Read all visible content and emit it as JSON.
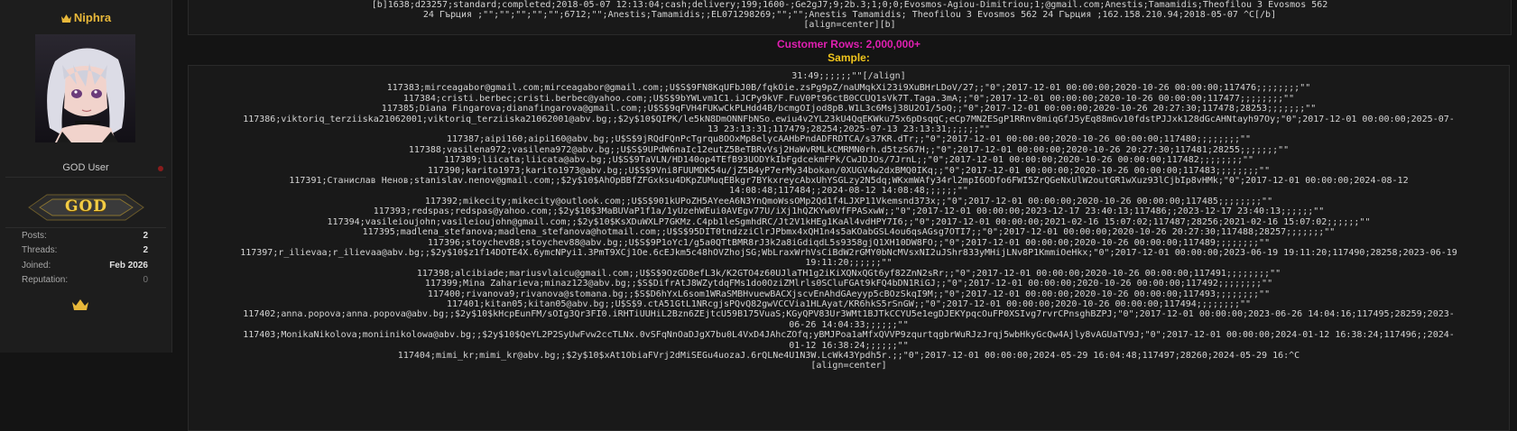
{
  "user": {
    "name": "Niphra",
    "title": "GOD User",
    "rank": "GOD",
    "stats": [
      {
        "label": "Posts:",
        "value": "2"
      },
      {
        "label": "Threads:",
        "value": "2"
      },
      {
        "label": "Joined:",
        "value": "Feb 2026"
      },
      {
        "label": "Reputation:",
        "value": "0"
      }
    ],
    "colors": {
      "name": "#e8b83a",
      "rank": "#f2cc45"
    },
    "icons": {
      "name_prefix": "crown-icon",
      "footer": "crown-icon",
      "online": "status-dot-icon"
    }
  },
  "top_block": {
    "lines": [
      "[b]1638;d23257;standard;completed;2018-05-07 12:13:04;cash;delivery;199;1600-;Ge2gJ7;9;2b.3;1;0;0;Evosmos-Agiou-Dimitriou;1;@gmail.com;Anestis;Tamamidis;Theofilou 3 Evosmos 562",
      "24 Гърция ;\"\";\"\";\"\";\"\";\"\";6712;\"\";Anestis;Tamamidis;;EL071298269;\"\";\"\";Anestis Tamamidis; Theofilou 3 Evosmos 562 24 Гърция ;162.158.210.94;2018-05-07 ^C[/b]",
      "[align=center][b]"
    ]
  },
  "headings": {
    "customers": "Customer Rows: 2,000,000+",
    "sample": "Sample:"
  },
  "sample": {
    "lines": [
      "31:49;;;;;;\"\"[/align]",
      "117383;mirceagabor@gmail.com;mirceagabor@gmail.com;;U$S$9FN8KqUFbJ0B/fqkOie.zsPg9pZ/naUMqkXi23i9XuBHrLDoV/27;;\"0\";2017-12-01 00:00:00;2020-10-26 00:00:00;117476;;;;;;;;\"\"",
      "117384;cristi.berbec;cristi.berbec@yahoo.com;;U$S$9bYWLvm1C1.iJCPy9kVF.FuV0Pt96ctB0CCUQ1sVk7T.Taga.3mA;;\"0\";2017-12-01 00:00:00;2020-10-26 00:00:00;117477;;;;;;;;\"\"",
      "117385;Diana Fingarova;dianafingarova@gmail.com;;U$S$9qFVH4FUKwCkPLHdd4B/bcmgOIjod8pB.W1L3c6Msj38U2O1/5oQ;;\"0\";2017-12-01 00:00:00;2020-10-26 20:27:30;117478;28253;;;;;;;\"\"",
      "117386;viktoriq_terziiska21062001;viktoriq_terziiska21062001@abv.bg;;$2y$10$QIPK/le5kN8DmONNFbNSo.ewiu4v2YL23kU4QqEKWku75x6pDsqqC;eCp7MN2ESgP1RRnv8miqGfJ5yEq88mGv10fdstPJJxk128dGcAHNtayh97Oy;\"0\";2017-12-01 00:00:00;2025-07-",
      "13 23:13:31;117479;28254;2025-07-13 23:13:31;;;;;;\"\"",
      "117387;aipi160;aipi160@abv.bg;;U$S$9jRQdFQnPcTgrqu8OOxMp8elycAAHbPndADFRDTCA/s37KR.dTr;;\"0\";2017-12-01 00:00:00;2020-10-26 00:00:00;117480;;;;;;;;\"\"",
      "117388;vasilena972;vasilena972@abv.bg;;U$S$9UPdW6naIc12eutZ5BeTBRvVsj2HaWvRMLkCMRMN0rh.d5tzS67H;;\"0\";2017-12-01 00:00:00;2020-10-26 20:27:30;117481;28255;;;;;;;\"\"",
      "117389;liicata;liicata@abv.bg;;U$S$9TaVLN/HD140op4TEfB93UODYkIbFgdcekmFPk/CwJDJOs/7JrnL;;\"0\";2017-12-01 00:00:00;2020-10-26 00:00:00;117482;;;;;;;;\"\"",
      "117390;karito1973;karito1973@abv.bg;;U$S$9Vni8FUUMDK54u/jZ5B4yP7erMy34bokan/0XUGV4w2dxBMQ0IKq;;\"0\";2017-12-01 00:00:00;2020-10-26 00:00:00;117483;;;;;;;;\"\"",
      "117391;Станислав Ненов;stanislav.nenov@gmail.com;;$2y$10$AhOpBBfZFGxksu4DKpZUMuqEBkgr7BYkxreycAbxUhYSGLzy2N5dq;WKxmWAfy34rl2mpI6ODfo6FWI5ZrQGeNxUlW2outGR1wXuz93lCjbIp8vHMk;\"0\";2017-12-01 00:00:00;2024-08-12",
      "14:08:48;117484;;2024-08-12 14:08:48;;;;;;\"\"",
      "117392;mikecity;mikecity@outlook.com;;U$S$901kUPoZH5AYeeA6N3YnQmoWssOMp2Qd1f4LJXP11Vkemsnd373x;;\"0\";2017-12-01 00:00:00;2020-10-26 00:00:00;117485;;;;;;;;\"\"",
      "117393;redspas;redspas@yahoo.com;;$2y$10$3MaBUVaP1f1a/1yUzehWEui0AVEgv77U/iXj1hQZKYw0VfFPASxwW;;\"0\";2017-12-01 00:00:00;2023-12-17 23:40:13;117486;;2023-12-17 23:40:13;;;;;;\"\"",
      "117394;vasileioujohn;vasileioujohn@gmail.com;;$2y$10$KsXDuWXLP7GKMz.C4pb1leSgmhdRC/Jt2V1kHEg1KaAl4vdHPY7I6;;\"0\";2017-12-01 00:00:00;2021-02-16 15:07:02;117487;28256;2021-02-16 15:07:02;;;;;;\"\"",
      "117395;madlena_stefanova;madlena_stefanova@hotmail.com;;U$S$95DIT0tndzziClrJPbmx4xQH1n4s5aKOabGSL4ou6qsAGsg7OTI7;;\"0\";2017-12-01 00:00:00;2020-10-26 20:27:30;117488;28257;;;;;;;\"\"",
      "117396;stoychev88;stoychev88@abv.bg;;U$S$9P1oYc1/g5a0QTtBMR8rJ3k2a8iGdiqdL5s9358gjQ1XH10DW8FO;;\"0\";2017-12-01 00:00:00;2020-10-26 00:00:00;117489;;;;;;;;\"\"",
      "117397;r_ilievaa;r_ilievaa@abv.bg;;$2y$10$z1f14DOTE4X.6ymcNPyi1.3PmT9XCj1Oe.6cEJkm5c48hOVZhojSG;WbLraxWrhVsCiBdW2rGMY0bNcMVsxNI2uJShr833yMHijLNv8P1KmmiOeHkx;\"0\";2017-12-01 00:00:00;2023-06-19 19:11:20;117490;28258;2023-06-19",
      "19:11:20;;;;;;\"\"",
      "117398;alcibiade;mariusvlaicu@gmail.com;;U$S$9OzGD8efL3k/K2GTO4z60UJlaTH1g2iKiXQNxQGt6yf82ZnN2sRr;;\"0\";2017-12-01 00:00:00;2020-10-26 00:00:00;117491;;;;;;;;\"\"",
      "117399;Mina Zaharieva;minaz123@abv.bg;;$S$DifrAtJ8WZytdqFMs1do0OziZMlrls0SCluFGAt9kFQ4bDN1RiGJ;;\"0\";2017-12-01 00:00:00;2020-10-26 00:00:00;117492;;;;;;;;\"\"",
      "117400;rivanova9;rivanova@stomana.bg;;$S$D6hYxL6som1WRaSMBHvuewBACXjscvEnAhdGAeyyp5cBOzSkqI9M;;\"0\";2017-12-01 00:00:00;2020-10-26 00:00:00;117493;;;;;;;;\"\"",
      "117401;kitan05;kitan05@abv.bg;;U$S$9.ctA51GtL1NRcgjsPQvQ82gwVCCVia1HLAyat/KR6hkS5rSnGW;;\"0\";2017-12-01 00:00:00;2020-10-26 00:00:00;117494;;;;;;;;\"\"",
      "117402;anna.popova;anna.popova@abv.bg;;$2y$10$kHcpEunFM/sOIg3Qr3FI0.iRHTiUUHiL2Bzn6ZEjtcU59B175VuaS;KGyQPV83Ur3WMt1BJTkCCYU5e1egDJEKYpqcOuFP0XSIvg7rvrCPnsghBZPJ;\"0\";2017-12-01 00:00:00;2023-06-26 14:04:16;117495;28259;2023-",
      "06-26 14:04:33;;;;;;\"\"",
      "117403;MonikaNikolova;moniinikolowa@abv.bg;;$2y$10$QeYL2P2SyUwFvw2ccTLNx.0vSFqNnOaDJgX7bu0L4VxD4JAhcZOfq;yBMJPoa1aMfxQVVP9zqurtqgbrWuRJzJrqj5wbHkyGcQw4Ajly8vAGUaTV9J;\"0\";2017-12-01 00:00:00;2024-01-12 16:38:24;117496;;2024-",
      "01-12 16:38:24;;;;;;\"\"",
      "117404;mimi_kr;mimi_kr@abv.bg;;$2y$10$xAt1ObiaFVrj2dMiSEGu4uozaJ.6rQLNe4U1N3W.LcWk43Ypdh5r.;;\"0\";2017-12-01 00:00:00;2024-05-29 16:04:48;117497;28260;2024-05-29 16:^C",
      "[align=center]"
    ]
  }
}
